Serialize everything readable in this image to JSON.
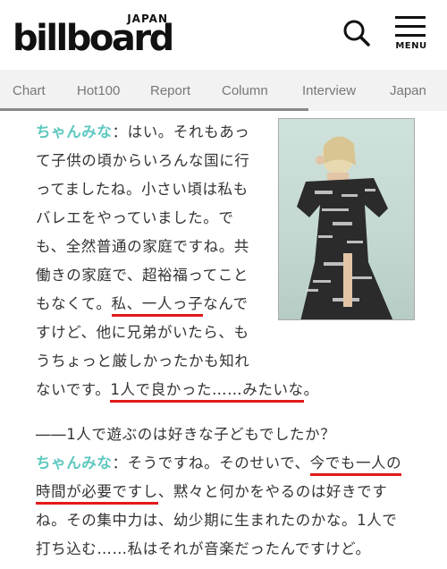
{
  "header": {
    "logo_small": "JAPAN",
    "logo_main": "billboard",
    "menu_label": "MENU"
  },
  "nav": {
    "items": [
      "Chart",
      "Hot100",
      "Report",
      "Column",
      "Interview",
      "Japan"
    ]
  },
  "article": {
    "speaker": "ちゃんみな",
    "photo_colors": {
      "background": "#c8ddd6",
      "dress": "#2b2b2b",
      "hair": "#e8d9b0"
    },
    "p1_lines": [
      "：はい。それもあっ",
      "て子供の頃からいろんな国に行",
      "ってましたね。小さい頃は私も",
      "バレエをやっていました。で",
      "も、全然普通の家庭ですね。共",
      "働きの家庭で、超裕福ってこと",
      "もなくて。",
      "私、一人っ子",
      "なんで",
      "すけど、他に兄弟がいたら、も",
      "うちょっと厳しかったかも知れ",
      "ないです。",
      "1人で良かった……みたいな",
      "。"
    ],
    "question": "――1人で遊ぶのは好きな子どもでしたか？",
    "p2_lines": [
      "：そうですね。そのせいで、",
      "今でも一人の",
      "時間が必要ですし",
      "、黙々と何かをやるのは好きです",
      "ね。その集中力は、幼少期に生まれたのかな。1人で",
      "打ち込む……私はそれが音楽だったんですけど。"
    ]
  },
  "colors": {
    "accent": "#5ec8c0",
    "underline": "#e21a1a"
  }
}
